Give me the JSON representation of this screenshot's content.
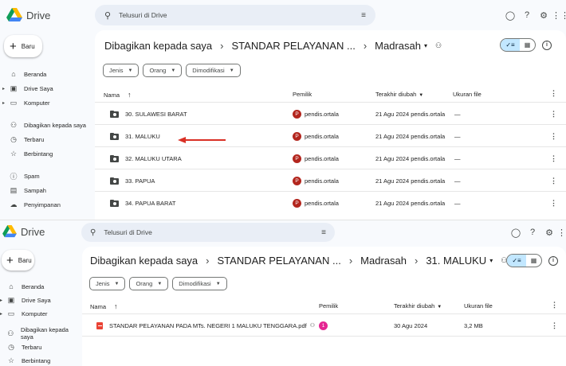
{
  "app": {
    "name": "Drive"
  },
  "colors": {
    "accent": "#c2e7ff",
    "arrow": "#d93025",
    "avatar_red": "#b3261e",
    "avatar_pink": "#e52592"
  },
  "search": {
    "placeholder": "Telusuri di Drive"
  },
  "new_button": {
    "label": "Baru"
  },
  "sidebar": {
    "items": [
      {
        "label": "Beranda",
        "icon": "home-icon"
      },
      {
        "label": "Drive Saya",
        "icon": "drive-icon"
      },
      {
        "label": "Komputer",
        "icon": "computer-icon"
      },
      {
        "label": "Dibagikan kepada saya",
        "icon": "shared-icon"
      },
      {
        "label": "Terbaru",
        "icon": "clock-icon"
      },
      {
        "label": "Berbintang",
        "icon": "star-icon"
      },
      {
        "label": "Spam",
        "icon": "spam-icon"
      },
      {
        "label": "Sampah",
        "icon": "trash-icon"
      },
      {
        "label": "Penyimpanan",
        "icon": "cloud-icon"
      }
    ]
  },
  "filters": [
    {
      "label": "Jenis"
    },
    {
      "label": "Orang"
    },
    {
      "label": "Dimodifikasi"
    }
  ],
  "columns": {
    "name": "Nama",
    "owner": "Pemilik",
    "modified": "Terakhir diubah",
    "size": "Ukuran file"
  },
  "pane1": {
    "breadcrumb": [
      "Dibagikan kepada saya",
      "STANDAR PELAYANAN ...",
      "Madrasah"
    ],
    "rows": [
      {
        "name": "30. SULAWESI BARAT",
        "owner": "pendis.ortala",
        "avatar": "P",
        "modified": "21 Agu 2024 pendis.ortala",
        "size": "—"
      },
      {
        "name": "31. MALUKU",
        "owner": "pendis.ortala",
        "avatar": "P",
        "modified": "21 Agu 2024 pendis.ortala",
        "size": "—"
      },
      {
        "name": "32. MALUKU UTARA",
        "owner": "pendis.ortala",
        "avatar": "P",
        "modified": "21 Agu 2024 pendis.ortala",
        "size": "—"
      },
      {
        "name": "33. PAPUA",
        "owner": "pendis.ortala",
        "avatar": "P",
        "modified": "21 Agu 2024 pendis.ortala",
        "size": "—"
      },
      {
        "name": "34. PAPUA BARAT",
        "owner": "pendis.ortala",
        "avatar": "P",
        "modified": "21 Agu 2024 pendis.ortala",
        "size": "—"
      }
    ]
  },
  "pane2": {
    "breadcrumb": [
      "Dibagikan kepada saya",
      "STANDAR PELAYANAN ...",
      "Madrasah",
      "31. MALUKU"
    ],
    "rows": [
      {
        "name": "STANDAR PELAYANAN PADA MTs. NEGERI 1 MALUKU TENGGARA.pdf",
        "avatar": "1",
        "modified": "30 Agu 2024",
        "size": "3,2 MB"
      }
    ]
  }
}
